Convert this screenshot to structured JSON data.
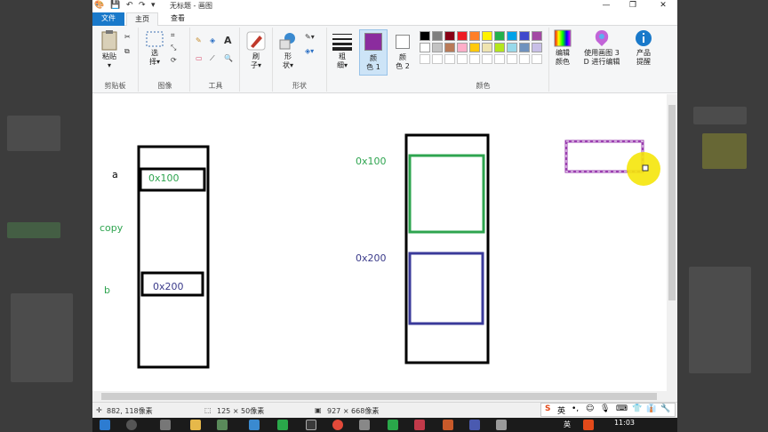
{
  "window": {
    "title": "无标题 - 画图"
  },
  "tabs": {
    "file": "文件",
    "home": "主页",
    "view": "查看"
  },
  "ribbon": {
    "clipboard": {
      "paste": "粘贴",
      "group": "剪贴板"
    },
    "image": {
      "select": "选",
      "select2": "择",
      "group": "图像"
    },
    "tools": {
      "group": "工具"
    },
    "brushes": {
      "label1": "刷",
      "label2": "子"
    },
    "shapes": {
      "label1": "形",
      "label2": "状",
      "group": "形状"
    },
    "size": {
      "label1": "粗",
      "label2": "细"
    },
    "color1": {
      "label1": "颜",
      "label2": "色 1"
    },
    "color2": {
      "label1": "颜",
      "label2": "色 2"
    },
    "colors_group": "颜色",
    "edit_colors": {
      "label1": "编辑",
      "label2": "颜色"
    },
    "paint3d": {
      "label1": "使用画图 3",
      "label2": "D 进行编辑"
    },
    "product": {
      "label1": "产品",
      "label2": "提醒"
    },
    "primary_color": "#8b2c9e",
    "palette": [
      "#000000",
      "#7f7f7f",
      "#880015",
      "#ed1c24",
      "#ff7f27",
      "#fff200",
      "#22b14c",
      "#00a2e8",
      "#3f48cc",
      "#a349a4",
      "#ffffff",
      "#c3c3c3",
      "#b97a57",
      "#ffaec9",
      "#ffc90e",
      "#efe4b0",
      "#b5e61d",
      "#99d9ea",
      "#7092be",
      "#c8bfe7"
    ]
  },
  "canvas": {
    "label_a": "a",
    "label_copy": "copy",
    "label_b": "b",
    "box_a": "0x100",
    "box_b": "0x200",
    "right_label_100": "0x100",
    "right_label_200": "0x200",
    "colors": {
      "green": "#2ea44f",
      "purple": "#3a3a9a",
      "black": "#000000",
      "selection": "#9b3fb0",
      "cursor_highlight": "#f5e60a"
    }
  },
  "status": {
    "cursor": "882, 118像素",
    "selection": "125 × 50像素",
    "canvas_size": "927 × 668像素"
  },
  "ime": {
    "mode": "英"
  },
  "taskbar": {
    "time": "11:03",
    "lang": "英"
  }
}
